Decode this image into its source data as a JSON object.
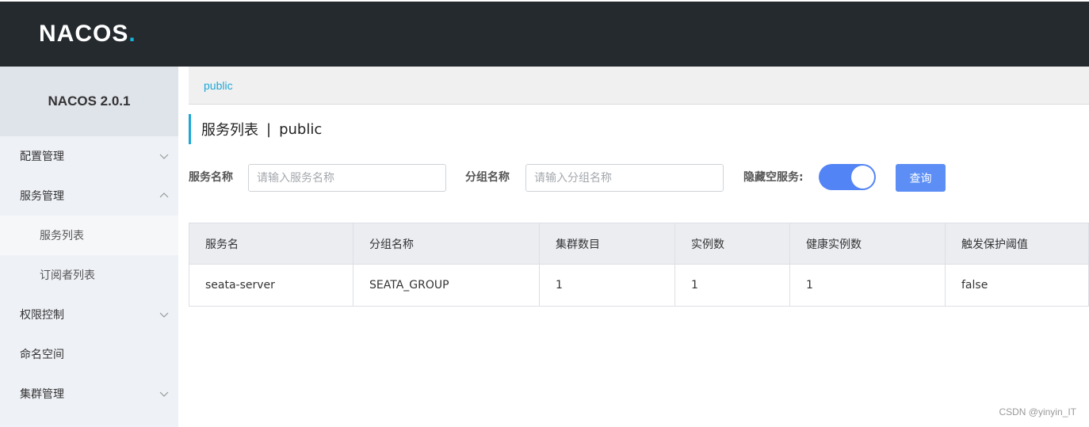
{
  "header": {
    "logo_text": "NACOS",
    "logo_dot": "."
  },
  "sidebar": {
    "title": "NACOS 2.0.1",
    "items": [
      {
        "label": "配置管理",
        "icon": "chevron-down-icon"
      },
      {
        "label": "服务管理",
        "icon": "chevron-up-icon"
      },
      {
        "label": "服务列表"
      },
      {
        "label": "订阅者列表"
      },
      {
        "label": "权限控制",
        "icon": "chevron-down-icon"
      },
      {
        "label": "命名空间"
      },
      {
        "label": "集群管理",
        "icon": "chevron-down-icon"
      }
    ]
  },
  "breadcrumb": {
    "namespace": "public"
  },
  "page": {
    "title": "服务列表",
    "separator": "|",
    "namespace": "public"
  },
  "filters": {
    "service_label": "服务名称",
    "service_placeholder": "请输入服务名称",
    "group_label": "分组名称",
    "group_placeholder": "请输入分组名称",
    "hide_empty_label": "隐藏空服务:",
    "hide_empty_on": true,
    "query_label": "查询"
  },
  "table": {
    "columns": [
      "服务名",
      "分组名称",
      "集群数目",
      "实例数",
      "健康实例数",
      "触发保护阈值"
    ],
    "rows": [
      [
        "seata-server",
        "SEATA_GROUP",
        "1",
        "1",
        "1",
        "false"
      ]
    ]
  },
  "watermark": "CSDN @yinyin_IT",
  "colors": {
    "topbar": "#252a2f",
    "accent": "#1fa7d6",
    "primary": "#5c8ef5",
    "sidebar": "#eef1f6"
  }
}
